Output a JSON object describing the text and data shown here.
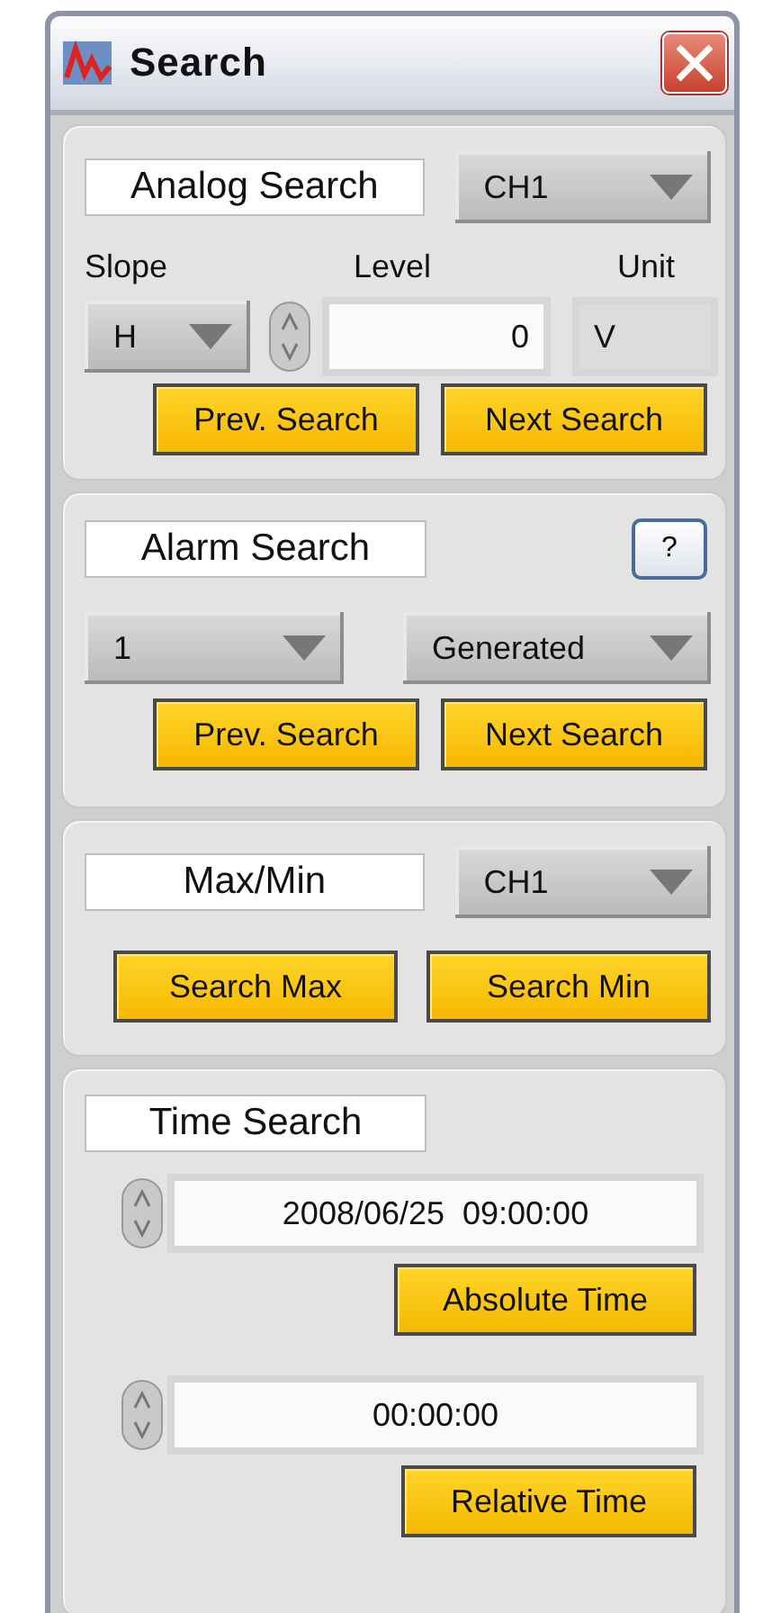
{
  "window": {
    "title": "Search"
  },
  "analog_search": {
    "title": "Analog Search",
    "channel": "CH1",
    "slope_label": "Slope",
    "level_label": "Level",
    "unit_label": "Unit",
    "slope": "H",
    "level_value": "0",
    "unit": "V",
    "buttons": [
      "Prev. Search",
      "Next Search"
    ]
  },
  "alarm_search": {
    "title": "Alarm Search",
    "help": "?",
    "number": "1",
    "mode": "Generated",
    "buttons": [
      "Prev. Search",
      "Next Search"
    ]
  },
  "max_min": {
    "title": "Max/Min",
    "channel": "CH1",
    "buttons": [
      "Search Max",
      "Search Min"
    ]
  },
  "time_search": {
    "title": "Time Search",
    "absolute": {
      "value": "2008/06/25  09:00:00",
      "button": "Absolute Time"
    },
    "relative": {
      "value": "00:00:00",
      "button": "Relative Time"
    }
  }
}
